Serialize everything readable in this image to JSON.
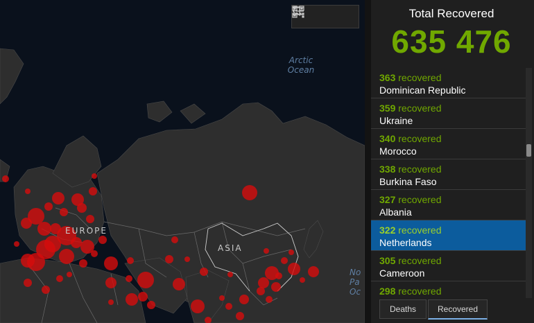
{
  "map": {
    "ocean_labels": [
      "Arctic",
      "Ocean"
    ],
    "edge_ocean_label": [
      "No",
      "Pa",
      "Oc"
    ],
    "region_labels": {
      "europe": "EUROPE",
      "asia": "ASIA"
    },
    "marker_color": "#d60c0c"
  },
  "toolbar": {
    "tools": [
      {
        "icon": "bookmark-icon"
      },
      {
        "icon": "legend-list-icon"
      },
      {
        "icon": "qr-grid-icon"
      }
    ]
  },
  "panel": {
    "title": "Total Recovered",
    "total": "635 476",
    "accent_color": "#70a800",
    "selected_color": "#0c5c9d",
    "items": [
      {
        "count": "363",
        "suffix": "recovered",
        "country": "Dominican Republic"
      },
      {
        "count": "359",
        "suffix": "recovered",
        "country": "Ukraine"
      },
      {
        "count": "340",
        "suffix": "recovered",
        "country": "Morocco"
      },
      {
        "count": "338",
        "suffix": "recovered",
        "country": "Burkina Faso"
      },
      {
        "count": "327",
        "suffix": "recovered",
        "country": "Albania"
      },
      {
        "count": "322",
        "suffix": "recovered",
        "country": "Netherlands",
        "selected": true
      },
      {
        "count": "305",
        "suffix": "recovered",
        "country": "Cameroon"
      },
      {
        "count": "298",
        "suffix": "recovered",
        "country": ""
      }
    ]
  },
  "tabs": [
    {
      "label": "Deaths",
      "active": false
    },
    {
      "label": "Recovered",
      "active": true
    }
  ]
}
